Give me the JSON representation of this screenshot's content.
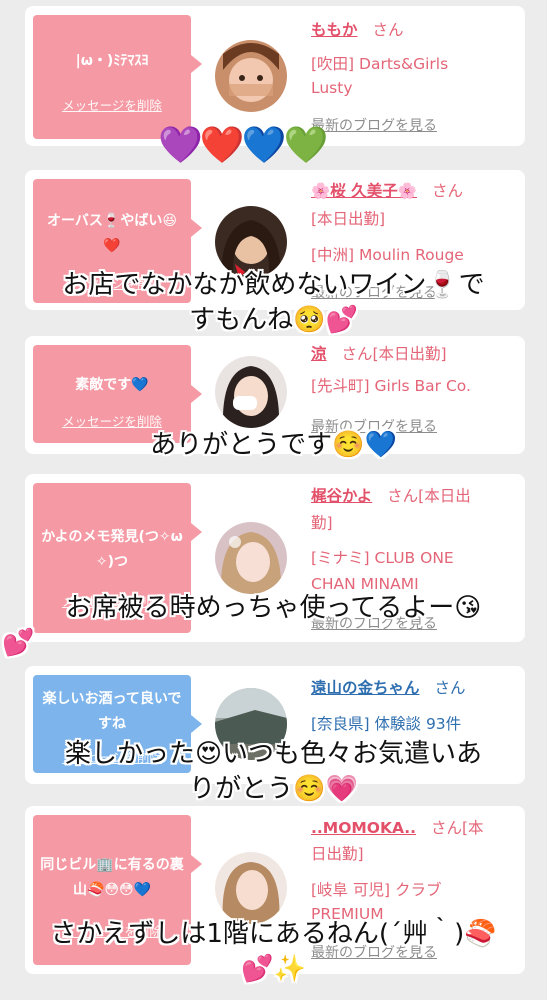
{
  "common": {
    "delete_label": "メッセージを削除",
    "blog_label": "最新のブログを見る",
    "san": "さん"
  },
  "cards": [
    {
      "bubble": "|ω・)ﾐﾃﾏｽﾖ",
      "bubble_color": "#f59aa4",
      "name": "ももか",
      "suffix": "さん",
      "lines": [
        "[吹田] Darts&Girls",
        "Lusty"
      ]
    },
    {
      "bubble": "オーバス🍷やばい😆❤️",
      "bubble_color": "#f59aa4",
      "name": "🌸桜 久美子🌸",
      "suffix": "さん",
      "lines": [
        "[本日出勤]",
        "[中洲] Moulin Rouge"
      ]
    },
    {
      "bubble": "素敵です💙",
      "bubble_color": "#f59aa4",
      "name": "涼",
      "suffix": "さん[本日出勤]",
      "lines": [
        "[先斗町] Girls Bar Co."
      ]
    },
    {
      "bubble": "かよのメモ発見(つ✧ω✧)つ",
      "bubble_color": "#f59aa4",
      "name": "梶谷かよ",
      "suffix": "さん[本日出",
      "name_line2": "勤]",
      "lines": [
        "[ミナミ] CLUB ONE",
        "CHAN MINAMI"
      ]
    },
    {
      "bubble": "楽しいお酒って良いですね",
      "bubble_color": "#7db4ec",
      "name": "遠山の金ちゃん",
      "suffix": "さん",
      "lines": [
        "[奈良県] 体験談 93件"
      ]
    },
    {
      "bubble": "同じビル🏢に有るの裏山🍣😳😳💙",
      "bubble_color": "#f59aa4",
      "name": "..MOMOKA..",
      "suffix": "さん[本",
      "name_line2": "日出勤]",
      "lines": [
        "[岐阜 可児] クラブ",
        "PREMIUM"
      ]
    }
  ],
  "overlays": {
    "hearts": "💜❤️💙💚",
    "caption_2_line1": "お店でなかなか飲めないワイン🍷で",
    "caption_2_line2": "すもんね🥺💕",
    "caption_3": "ありがとうです☺️💙",
    "caption_4_line1": "お席被る時めっちゃ使ってるよー😘",
    "caption_4_line2": "💕",
    "caption_5_line1": "楽しかった😍いつも色々お気遣いあ",
    "caption_5_line2": "りがとう☺️💗",
    "caption_6_line1": "さかえずしは1階にあるねん(´艸｀)🍣",
    "caption_6_line2": "💕✨"
  }
}
